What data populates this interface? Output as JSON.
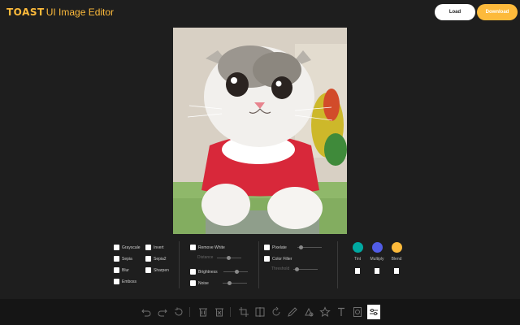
{
  "header": {
    "brand": "TOAST",
    "title": "UI Image Editor",
    "load_label": "Load",
    "download_label": "Download"
  },
  "filters": {
    "grayscale": "Grayscale",
    "invert": "Invert",
    "sepia": "Sepia",
    "sepia2": "Sepia2",
    "blur": "Blur",
    "sharpen": "Sharpen",
    "emboss": "Emboss",
    "remove_white": "Remove White",
    "distance": "Distance",
    "brightness": "Brightness",
    "noise": "Noise",
    "pixelate": "Pixelate",
    "color_filter": "Color Filter",
    "threshold": "Threshold"
  },
  "colors": {
    "tint_label": "Tint",
    "multiply_label": "Multiply",
    "blend_label": "Blend",
    "tint_color": "#00a9a1",
    "multiply_color": "#515ce6",
    "blend_color": "#fdba3b"
  },
  "toolbar": {
    "icons": [
      "undo-icon",
      "redo-icon",
      "reset-icon",
      "delete-icon",
      "delete-all-icon",
      "crop-icon",
      "flip-icon",
      "rotate-icon",
      "draw-icon",
      "shape-icon",
      "star-icon",
      "text-icon",
      "mask-icon",
      "filter-icon"
    ]
  },
  "accent": "#fdba3b"
}
